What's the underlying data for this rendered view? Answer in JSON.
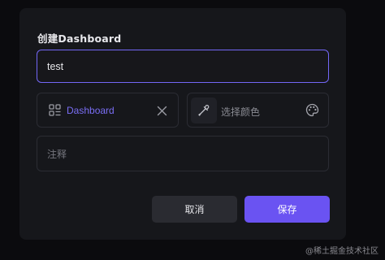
{
  "dialog": {
    "title": "创建Dashboard",
    "name_input": {
      "value": "test",
      "placeholder": ""
    },
    "type_select": {
      "icon": "grid-icon",
      "value": "Dashboard",
      "clear_icon": "close-icon"
    },
    "color_picker": {
      "picker_icon": "eyedropper-icon",
      "placeholder": "选择颜色",
      "palette_icon": "palette-icon"
    },
    "note_field": {
      "placeholder": "注释"
    },
    "buttons": {
      "cancel_label": "取消",
      "save_label": "保存"
    }
  },
  "watermark": "@稀土掘金技术社区",
  "colors": {
    "accent": "#7367f6",
    "save_button": "#6a53f2",
    "select_value": "#7a6ef5",
    "dialog_bg": "#16171b",
    "page_bg": "#0b0b0e"
  }
}
